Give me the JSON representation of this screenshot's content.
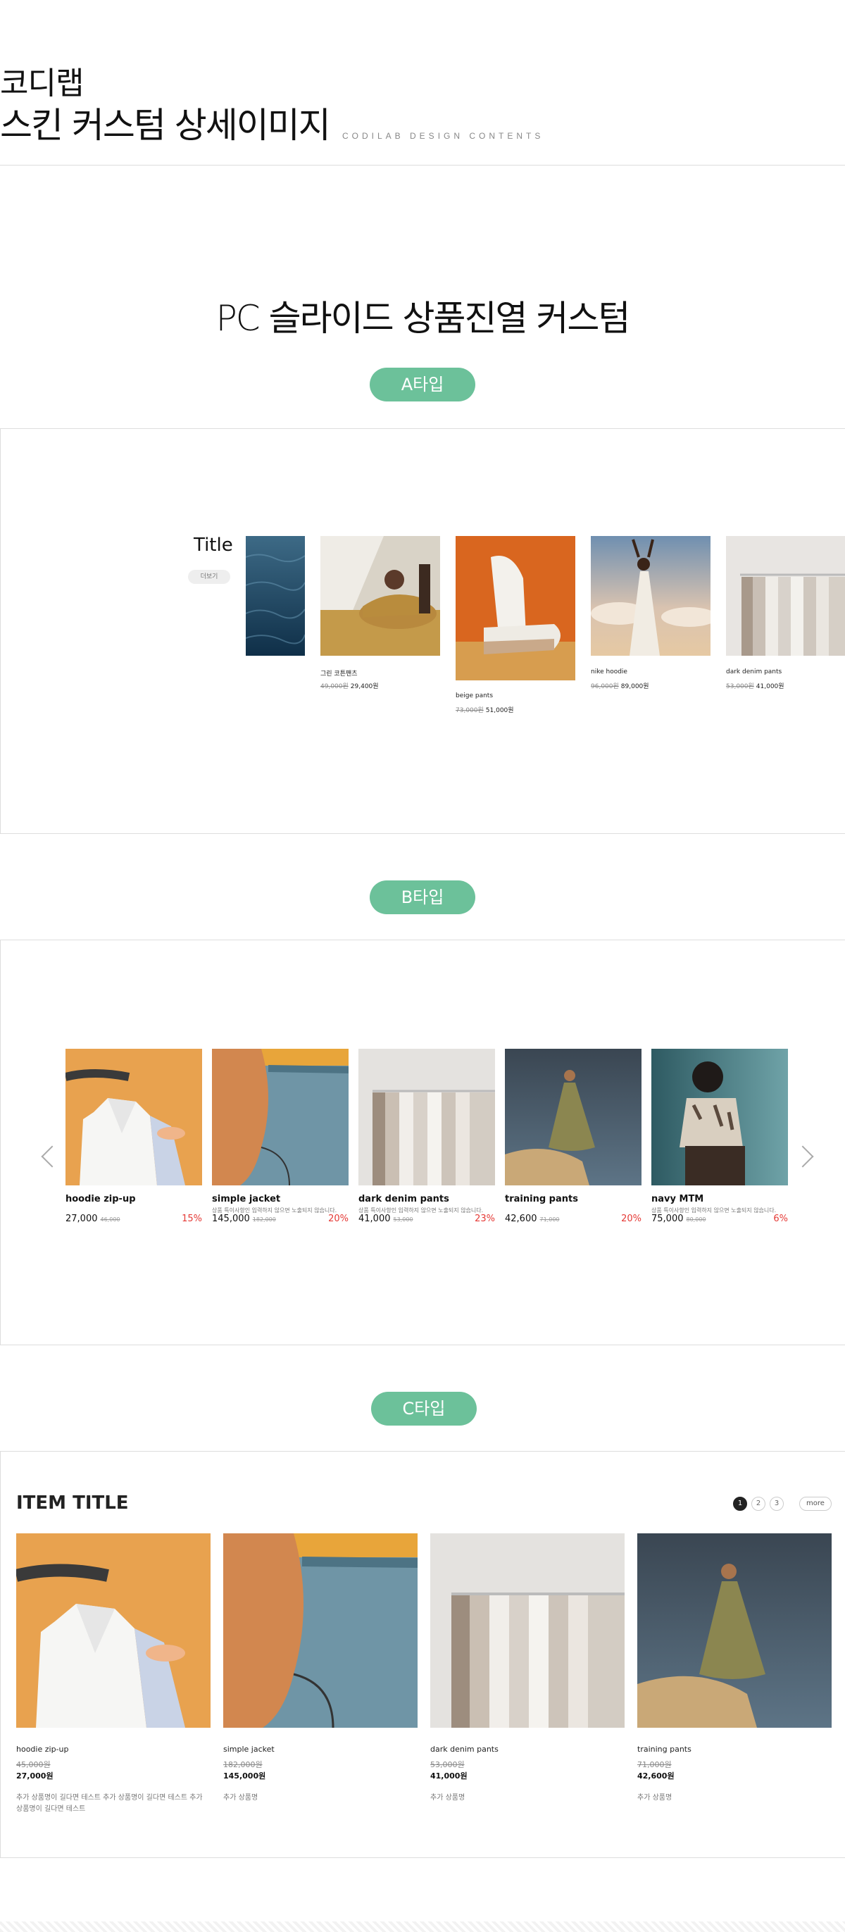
{
  "header": {
    "line1": "코디랩",
    "line2": "스킨 커스텀 상세이미지",
    "subtitle": "CODILAB DESIGN CONTENTS"
  },
  "section_title": "PC 슬라이드 상품진열 커스텀",
  "type_a": {
    "label": "A타입",
    "title": "Title",
    "more": "더보기",
    "products": [
      {
        "name": "그린 코튼팬츠",
        "old": "49,000원",
        "price": "29,400원"
      },
      {
        "name": "beige pants",
        "old": "73,000원",
        "price": "51,000원"
      },
      {
        "name": "nike hoodie",
        "old": "96,000원",
        "price": "89,000원"
      },
      {
        "name": "dark denim pants",
        "old": "53,000원",
        "price": "41,000원"
      }
    ]
  },
  "type_b": {
    "label": "B타입",
    "products": [
      {
        "name": "hoodie zip-up",
        "desc": "",
        "price": "27,000",
        "old": "46,000",
        "rate": "15%"
      },
      {
        "name": "simple jacket",
        "desc": "상품 특이사항인 입력하지 않으면 노출되지 않습니다.",
        "price": "145,000",
        "old": "182,000",
        "rate": "20%"
      },
      {
        "name": "dark denim pants",
        "desc": "상품 특이사항인 입력하지 않으면 노출되지 않습니다.",
        "price": "41,000",
        "old": "53,000",
        "rate": "23%"
      },
      {
        "name": "training pants",
        "desc": "",
        "price": "42,600",
        "old": "71,000",
        "rate": "20%"
      },
      {
        "name": "navy MTM",
        "desc": "상품 특이사항인 입력하지 않으면 노출되지 않습니다.",
        "price": "75,000",
        "old": "80,000",
        "rate": "6%"
      }
    ]
  },
  "type_c": {
    "label": "C타입",
    "title": "ITEM TITLE",
    "pages": [
      "1",
      "2",
      "3"
    ],
    "more": "more",
    "products": [
      {
        "name": "hoodie zip-up",
        "old": "45,000원",
        "price": "27,000원",
        "desc": "추가 상품명이 길다면 테스트 추가 상품명이 길다면 테스트 추가 상품명이 길다면 테스트"
      },
      {
        "name": "simple jacket",
        "old": "182,000원",
        "price": "145,000원",
        "desc": "추가 상품명"
      },
      {
        "name": "dark denim pants",
        "old": "53,000원",
        "price": "41,000원",
        "desc": "추가 상품명"
      },
      {
        "name": "training pants",
        "old": "71,000원",
        "price": "42,600원",
        "desc": "추가 상품명"
      }
    ]
  },
  "colors": {
    "accent": "#6cc19a",
    "sale": "#e53935"
  }
}
